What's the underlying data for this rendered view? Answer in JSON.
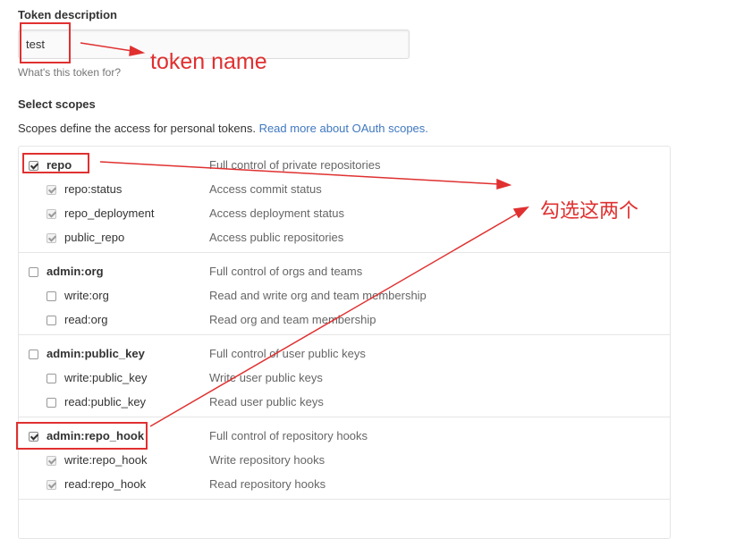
{
  "token": {
    "label": "Token description",
    "value": "test",
    "help": "What's this token for?"
  },
  "scopes_section": {
    "title": "Select scopes",
    "intro": "Scopes define the access for personal tokens.",
    "link_text": "Read more about OAuth scopes."
  },
  "scopes": [
    {
      "name": "repo",
      "desc": "Full control of private repositories",
      "checked": true,
      "parent": true
    },
    {
      "name": "repo:status",
      "desc": "Access commit status",
      "checked": true,
      "parent": false
    },
    {
      "name": "repo_deployment",
      "desc": "Access deployment status",
      "checked": true,
      "parent": false
    },
    {
      "name": "public_repo",
      "desc": "Access public repositories",
      "checked": true,
      "parent": false
    },
    {
      "name": "admin:org",
      "desc": "Full control of orgs and teams",
      "checked": false,
      "parent": true
    },
    {
      "name": "write:org",
      "desc": "Read and write org and team membership",
      "checked": false,
      "parent": false
    },
    {
      "name": "read:org",
      "desc": "Read org and team membership",
      "checked": false,
      "parent": false
    },
    {
      "name": "admin:public_key",
      "desc": "Full control of user public keys",
      "checked": false,
      "parent": true
    },
    {
      "name": "write:public_key",
      "desc": "Write user public keys",
      "checked": false,
      "parent": false
    },
    {
      "name": "read:public_key",
      "desc": "Read user public keys",
      "checked": false,
      "parent": false
    },
    {
      "name": "admin:repo_hook",
      "desc": "Full control of repository hooks",
      "checked": true,
      "parent": true
    },
    {
      "name": "write:repo_hook",
      "desc": "Write repository hooks",
      "checked": true,
      "parent": false
    },
    {
      "name": "read:repo_hook",
      "desc": "Read repository hooks",
      "checked": true,
      "parent": false
    }
  ],
  "annotations": {
    "token_name": "token name",
    "select_two": "勾选这两个"
  },
  "colors": {
    "annotation": "#e03030",
    "link": "#4078c0"
  }
}
